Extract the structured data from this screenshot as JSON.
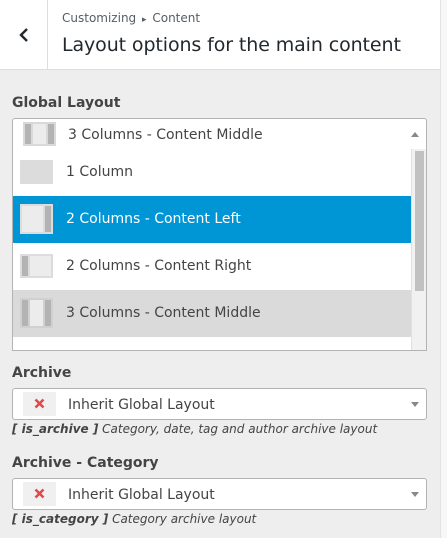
{
  "header": {
    "breadcrumb_parent": "Customizing",
    "breadcrumb_sep": "▸",
    "breadcrumb_current": "Content",
    "title": "Layout options for the main content"
  },
  "global_layout": {
    "label": "Global Layout",
    "selected": "3 Columns - Content Middle",
    "options": [
      {
        "label": "1 Column",
        "icon": "one-column-icon",
        "state": "normal"
      },
      {
        "label": "2 Columns - Content Left",
        "icon": "two-columns-left-icon",
        "state": "highlighted"
      },
      {
        "label": "2 Columns - Content Right",
        "icon": "two-columns-right-icon",
        "state": "normal"
      },
      {
        "label": "3 Columns - Content Middle",
        "icon": "three-columns-middle-icon",
        "state": "selected"
      }
    ]
  },
  "archive": {
    "label": "Archive",
    "selected": "Inherit Global Layout",
    "desc_tag": "[ is_archive ]",
    "desc_text": " Category, date, tag and author archive layout"
  },
  "archive_category": {
    "label": "Archive - Category",
    "selected": "Inherit Global Layout",
    "desc_tag": "[ is_category ]",
    "desc_text": " Category archive layout"
  },
  "colors": {
    "highlight": "#0095d4",
    "hover": "#dadada",
    "inherit_icon": "#dd4b4b"
  }
}
